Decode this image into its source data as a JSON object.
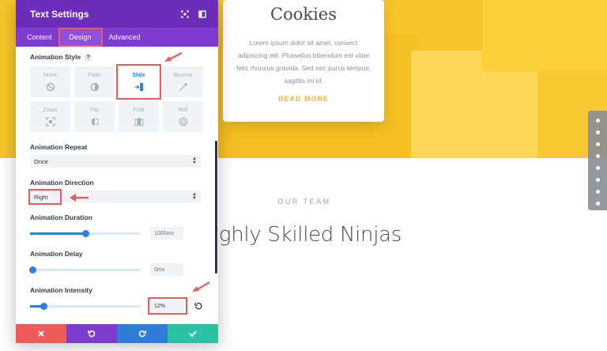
{
  "background": {
    "card": {
      "title": "Cookies",
      "body": "Lorem ipsum dolor sit amet, consect adipiscing elit. Phasellus bibendum est vitae felis rhoncus gravida. Sed nec purus tempus, sagittis mi id.",
      "link": "READ MORE"
    },
    "section_eyebrow": "OUR TEAM",
    "section_title": "ighly Skilled Ninjas",
    "dot_nav_count": 8
  },
  "modal": {
    "title": "Text Settings",
    "tabs": [
      {
        "label": "Content",
        "active": false
      },
      {
        "label": "Design",
        "active": true
      },
      {
        "label": "Advanced",
        "active": false
      }
    ],
    "animation_style": {
      "label": "Animation Style",
      "help": "?",
      "options": [
        {
          "label": "None",
          "icon": "none-icon",
          "active": false
        },
        {
          "label": "Fade",
          "icon": "fade-icon",
          "active": false
        },
        {
          "label": "Slide",
          "icon": "slide-icon",
          "active": true
        },
        {
          "label": "Bounce",
          "icon": "bounce-icon",
          "active": false
        },
        {
          "label": "Zoom",
          "icon": "zoom-icon",
          "active": false
        },
        {
          "label": "Flip",
          "icon": "flip-icon",
          "active": false
        },
        {
          "label": "Fold",
          "icon": "fold-icon",
          "active": false
        },
        {
          "label": "Roll",
          "icon": "roll-icon",
          "active": false
        }
      ]
    },
    "animation_repeat": {
      "label": "Animation Repeat",
      "value": "Once"
    },
    "animation_direction": {
      "label": "Animation Direction",
      "value": "Right"
    },
    "animation_duration": {
      "label": "Animation Duration",
      "value": "1000ms",
      "fraction": 0.5
    },
    "animation_delay": {
      "label": "Animation Delay",
      "value": "0ms",
      "fraction": 0.0
    },
    "animation_intensity": {
      "label": "Animation Intensity",
      "value": "12%",
      "fraction": 0.12
    },
    "colors": {
      "header": "#6c2eb9",
      "tabs": "#7e3bd0",
      "accent": "#2e80d8",
      "highlight": "#ee5a5a",
      "cancel": "#ee5a5a",
      "undo": "#7d3cd0",
      "redo": "#2e7bd8",
      "save": "#2bc1a3"
    }
  }
}
